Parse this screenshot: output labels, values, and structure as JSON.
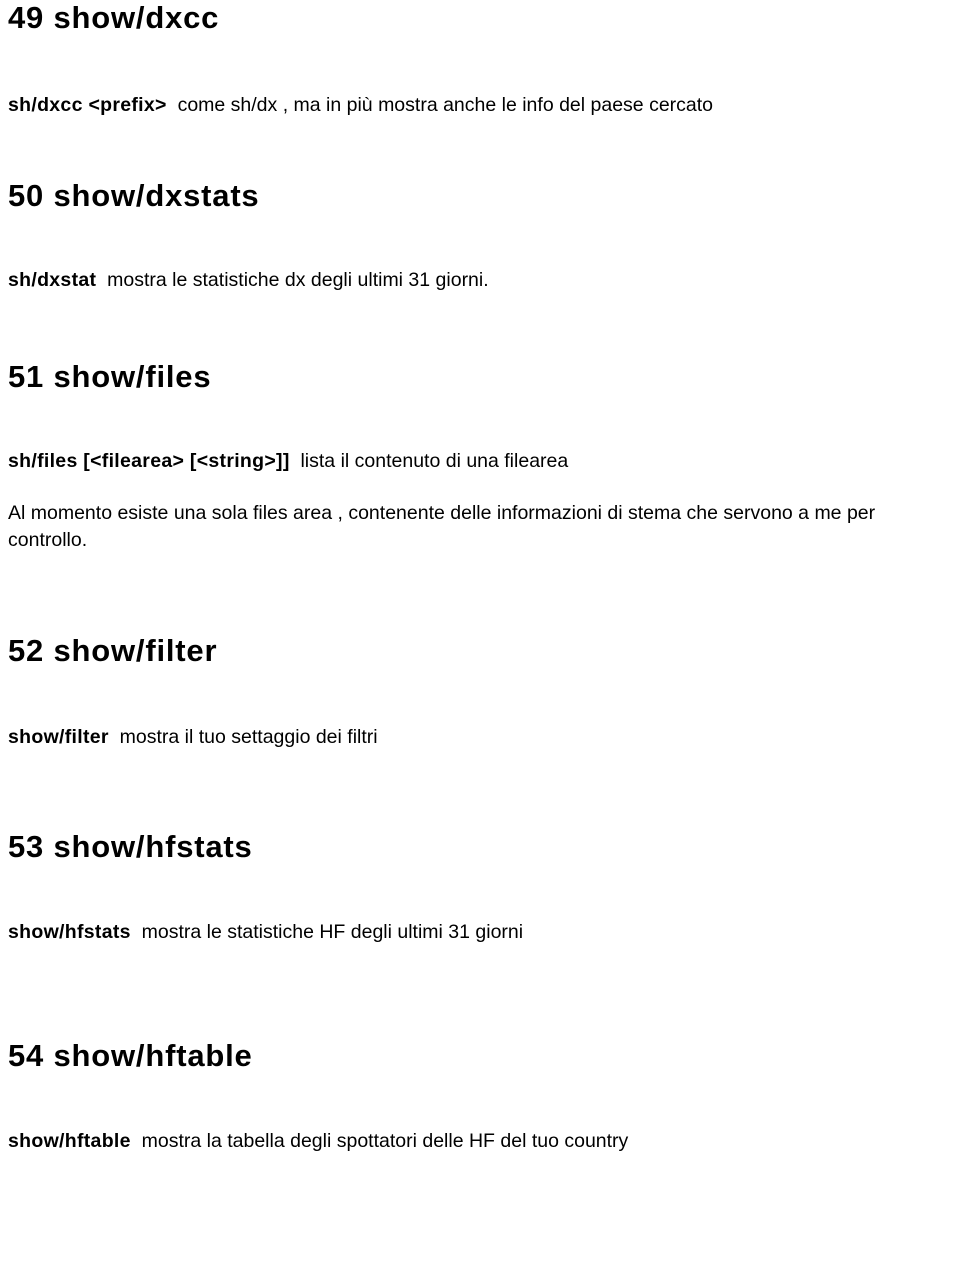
{
  "document": {
    "language": "it",
    "text_color": "#000000",
    "background_color": "#ffffff"
  },
  "sections": [
    {
      "number": "49",
      "heading": "49 show/dxcc",
      "command_syntax": "sh/dxcc <prefix>",
      "command_description": "come sh/dx , ma in più mostra anche le info del paese cercato",
      "paragraph": ""
    },
    {
      "number": "50",
      "heading": "50 show/dxstats",
      "command_syntax": "sh/dxstat",
      "command_description": "mostra le statistiche dx degli ultimi 31 giorni.",
      "paragraph": ""
    },
    {
      "number": "51",
      "heading": "51 show/files",
      "command_syntax": "sh/files [<filearea>  [<string>]]",
      "command_description": "lista il contenuto di una filearea",
      "paragraph": "Al momento esiste una sola files area , contenente delle informazioni di stema che servono a me per controllo."
    },
    {
      "number": "52",
      "heading": "52 show/filter",
      "command_syntax": "show/filter",
      "command_description": "mostra il tuo settaggio dei filtri",
      "paragraph": ""
    },
    {
      "number": "53",
      "heading": "53 show/hfstats",
      "command_syntax": "show/hfstats",
      "command_description": "mostra le statistiche HF degli ultimi 31 giorni",
      "paragraph": ""
    },
    {
      "number": "54",
      "heading": "54 show/hftable",
      "command_syntax": "show/hftable",
      "command_description": "mostra la tabella degli spottatori delle HF del tuo country",
      "paragraph": ""
    }
  ]
}
